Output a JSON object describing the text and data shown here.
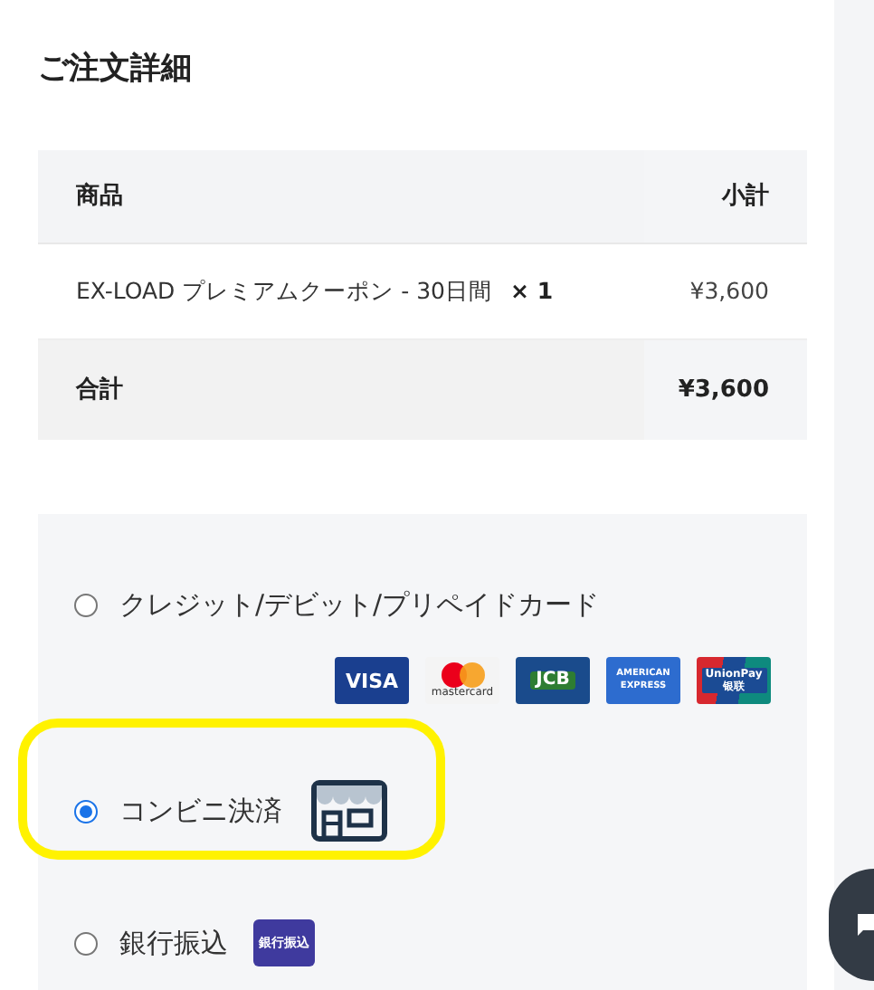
{
  "title": "ご注文詳細",
  "table": {
    "columns": [
      "商品",
      "小計"
    ],
    "rows": [
      {
        "product": "EX-LOAD プレミアムクーポン - 30日間",
        "quantity": "× 1",
        "subtotal": "¥3,600"
      }
    ],
    "total": {
      "label": "合計",
      "value": "¥3,600"
    }
  },
  "payment_options": [
    {
      "kind": "card",
      "label": "クレジット/デビット/プリペイドカード",
      "selected": false,
      "highlighted": false,
      "logos": [
        {
          "kind": "visa",
          "text": "VISA"
        },
        {
          "kind": "mastercard",
          "text": "mastercard"
        },
        {
          "kind": "jcb",
          "text": "JCB"
        },
        {
          "kind": "amex",
          "text": "AMERICAN EXPRESS"
        },
        {
          "kind": "unionpay",
          "text": "UnionPay 银联"
        }
      ]
    },
    {
      "kind": "store",
      "label": "コンビニ決済",
      "selected": true,
      "highlighted": true
    },
    {
      "kind": "bank",
      "label": "銀行振込",
      "selected": false,
      "highlighted": false,
      "badge": "銀行振込"
    }
  ]
}
